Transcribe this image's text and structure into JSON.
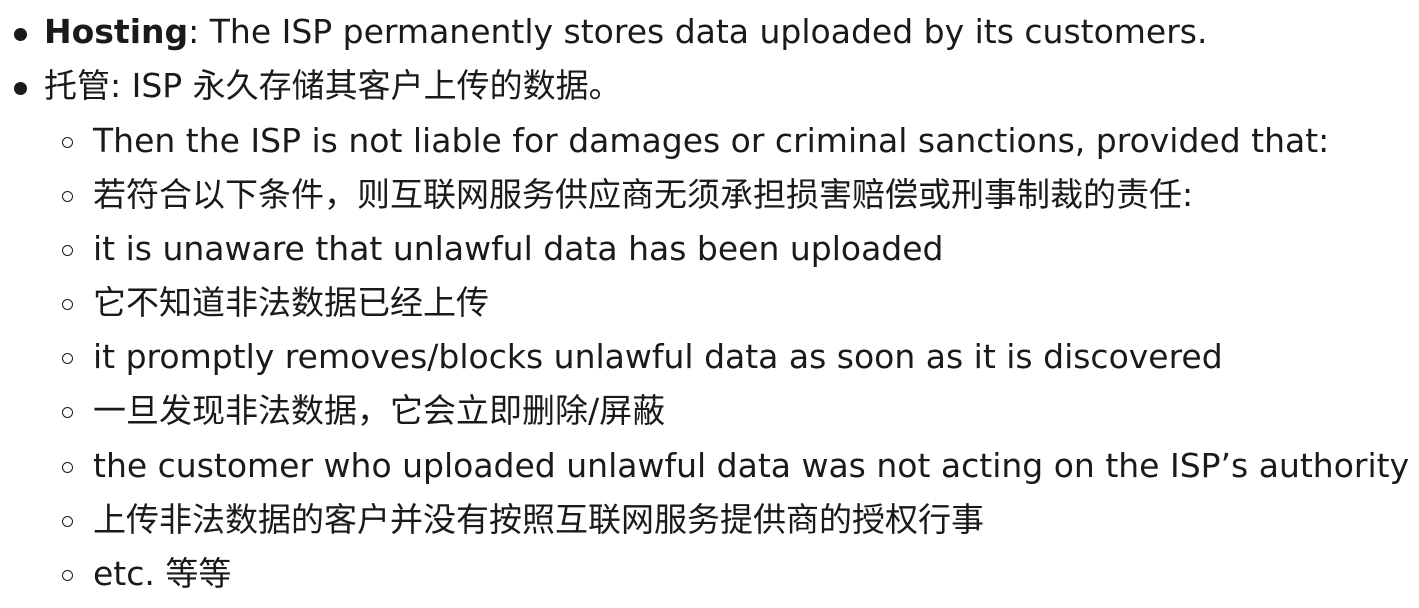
{
  "list": {
    "top_items": [
      {
        "term": "Hosting",
        "text": ": The ISP permanently stores data uploaded by its customers."
      },
      {
        "text": "托管: ISP 永久存储其客户上传的数据。"
      }
    ],
    "sub_items": [
      "Then the ISP is not liable for damages or criminal sanctions, provided that:",
      "若符合以下条件，则互联网服务供应商无须承担损害赔偿或刑事制裁的责任:",
      "it is unaware that unlawful data has been uploaded",
      "它不知道非法数据已经上传",
      "it promptly removes/blocks unlawful data as soon as it is discovered",
      "一旦发现非法数据，它会立即删除/屏蔽",
      "the customer who uploaded unlawful data was not acting on the ISP’s authority",
      "上传非法数据的客户并没有按照互联网服务提供商的授权行事",
      "etc. 等等"
    ]
  }
}
